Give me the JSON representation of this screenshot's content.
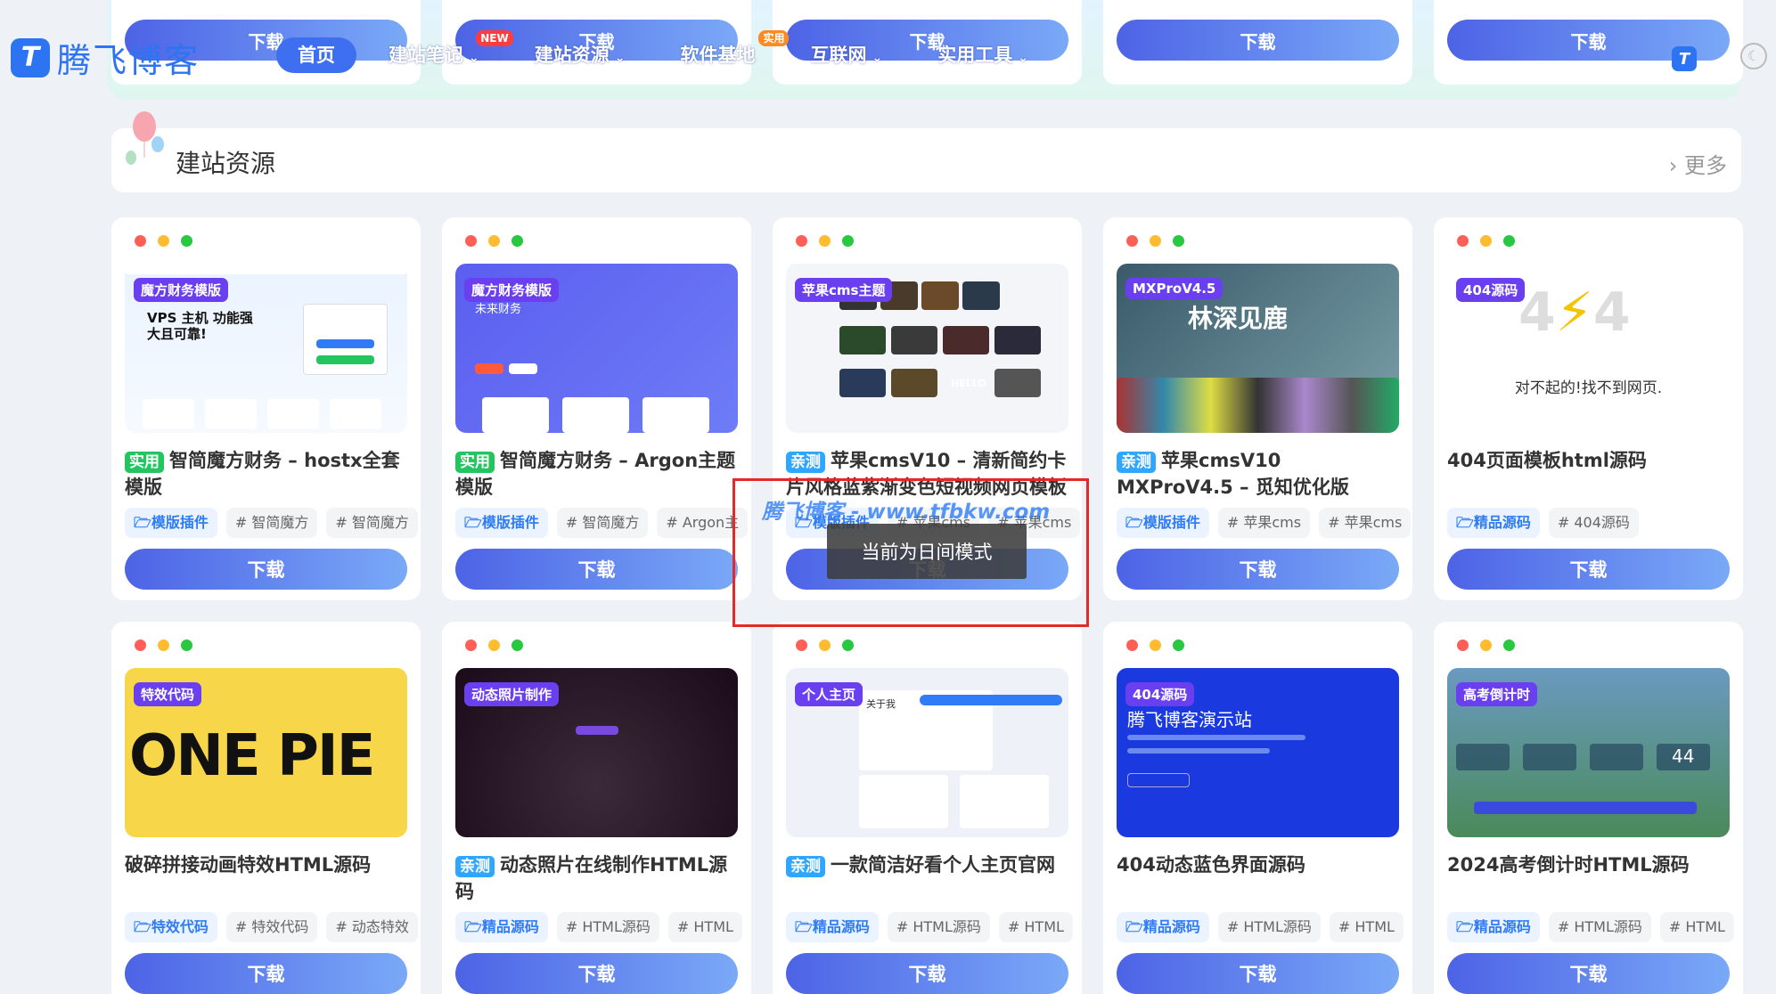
{
  "brand": {
    "logo_text": "腾飞博客",
    "logo_mark": "T"
  },
  "nav": [
    {
      "label": "首页",
      "active": true
    },
    {
      "label": "建站笔记",
      "badge": "NEW"
    },
    {
      "label": "建站资源"
    },
    {
      "label": "软件基地",
      "badge": "实用"
    },
    {
      "label": "互联网"
    },
    {
      "label": "实用工具"
    }
  ],
  "top_download_label": "下载",
  "section": {
    "title": "建站资源",
    "more": "更多"
  },
  "cards": [
    {
      "tag": "魔方财务模版",
      "badge": "实用",
      "badge_color": "green",
      "title": "智简魔方财务 – hostx全套模版",
      "tags": [
        "模版插件",
        "# 智简魔方",
        "# 智简魔方"
      ],
      "download": "下载",
      "thumb_text": "VPS 主机 功能强大且可靠!"
    },
    {
      "tag": "魔方财务模版",
      "badge": "实用",
      "badge_color": "green",
      "title": "智简魔方财务 – Argon主题模版",
      "tags": [
        "模版插件",
        "# 智简魔方",
        "# Argon主"
      ],
      "download": "下载",
      "thumb_text": "未来财务"
    },
    {
      "tag": "苹果cms主题",
      "badge": "亲测",
      "badge_color": "blue",
      "title": "苹果cmsV10 – 清新简约卡片风格蓝紫渐变色短视频网页模板",
      "tags": [
        "模版插件",
        "# 苹果cms",
        "# 苹果cms"
      ],
      "download": "下载",
      "thumb_text": "HELLO"
    },
    {
      "tag": "MXProV4.5",
      "badge": "亲测",
      "badge_color": "blue",
      "title": "苹果cmsV10 MXProV4.5 – 觅知优化版",
      "tags": [
        "模版插件",
        "# 苹果cms",
        "# 苹果cms"
      ],
      "download": "下载",
      "thumb_text": "林深见鹿"
    },
    {
      "tag": "404源码",
      "badge": "",
      "title": "404页面模板html源码",
      "tags": [
        "精品源码",
        "# 404源码"
      ],
      "download": "下载",
      "thumb_text": "对不起的!找不到网页."
    },
    {
      "tag": "特效代码",
      "badge": "",
      "title": "破碎拼接动画特效HTML源码",
      "tags": [
        "特效代码",
        "# 特效代码",
        "# 动态特效"
      ],
      "download": "下载",
      "thumb_text": "ONE PIE"
    },
    {
      "tag": "动态照片制作",
      "badge": "亲测",
      "badge_color": "blue",
      "title": "动态照片在线制作HTML源码",
      "tags": [
        "精品源码",
        "# HTML源码",
        "# HTML"
      ],
      "download": "下载",
      "thumb_text": ""
    },
    {
      "tag": "个人主页",
      "badge": "亲测",
      "badge_color": "blue",
      "title": "一款简洁好看个人主页官网",
      "tags": [
        "精品源码",
        "# HTML源码",
        "# HTML"
      ],
      "download": "下载",
      "thumb_text": "关于我"
    },
    {
      "tag": "404源码",
      "badge": "",
      "title": "404动态蓝色界面源码",
      "tags": [
        "精品源码",
        "# HTML源码",
        "# HTML"
      ],
      "download": "下载",
      "thumb_text": "腾飞博客演示站"
    },
    {
      "tag": "高考倒计时",
      "badge": "",
      "title": "2024高考倒计时HTML源码",
      "tags": [
        "精品源码",
        "# HTML源码",
        "# HTML"
      ],
      "download": "下载",
      "thumb_text": "44"
    }
  ],
  "toast": "当前为日间模式",
  "watermark": "腾飞博客 - www.tfbkw.com",
  "colors": {
    "accent": "#3d6ff0",
    "tag": "#6a3ff0",
    "badge_blue": "#2fa6ff",
    "badge_green": "#22c55e"
  }
}
